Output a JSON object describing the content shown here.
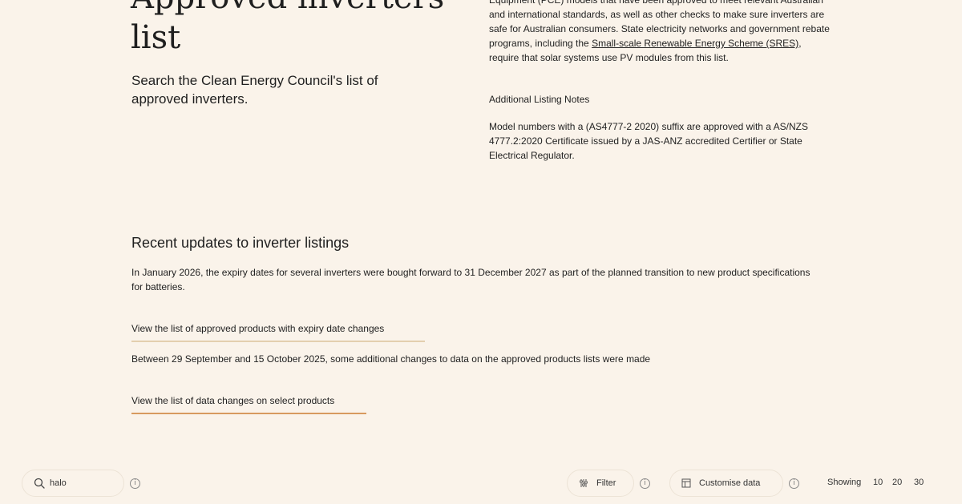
{
  "hero": {
    "title": "Approved inverters list",
    "subtitle": "Search the Clean Energy Council's list of approved inverters."
  },
  "intro": {
    "text_before_link": "Equipment (PCE) models that have been approved to meet relevant Australian and international standards, as well as other checks to make sure inverters are safe for Australian consumers. State electricity networks and government rebate programs, including the ",
    "link_label": "Small-scale Renewable Energy Scheme (SRES)",
    "text_after_link": ", require that solar systems use PV modules from this list.",
    "notes_title": "Additional Listing Notes",
    "notes_body": "Model numbers with a (AS4777-2 2020) suffix are approved with a AS/NZS 4777.2:2020 Certificate issued by a JAS-ANZ accredited Certifier or State Electrical Regulator."
  },
  "updates": {
    "title": "Recent updates to inverter listings",
    "paragraph": "In January 2026, the expiry dates for several inverters were bought forward to 31 December 2027 as part of the planned transition to new product specifications for batteries.",
    "expiry_link": "View the list of approved products with expiry date changes",
    "changes_text": "Between 29 September and 15 October 2025, some additional changes to data on the approved products lists were made",
    "changes_link": "View the list of data changes on select products"
  },
  "toolbar": {
    "search_value": "halo",
    "search_icon": "search-icon",
    "filter_label": "Filter",
    "filter_icon": "filter-icon",
    "customise_label": "Customise data",
    "customise_icon": "table-icon",
    "info_glyph": "i",
    "showing_label": "Showing",
    "page_sizes": [
      "10",
      "20",
      "30"
    ]
  },
  "colors": {
    "background": "#faf3ea",
    "link_underline_light": "#e3cfae",
    "link_underline_accent": "#d79a5f"
  }
}
